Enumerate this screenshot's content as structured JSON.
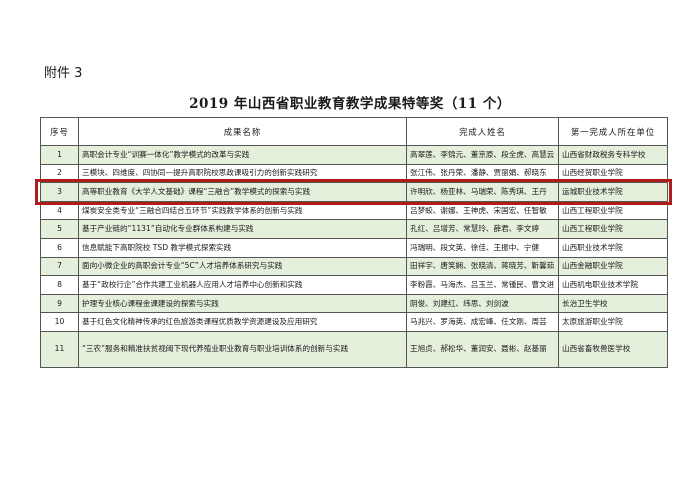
{
  "attachment_label": "附件 3",
  "title": "2019 年山西省职业教育教学成果特等奖（11 个）",
  "table": {
    "headers": [
      "序号",
      "成果名称",
      "完成人姓名",
      "第一完成人所在单位"
    ],
    "rows": [
      {
        "no": "1",
        "name": "高职会计专业“训赛一体化”教学模式的改革与实践",
        "people": "高翠莲、李锦元、董京原、段全虎、高慧云",
        "org": "山西省财政税务专科学校"
      },
      {
        "no": "2",
        "name": "三模块、四维度、四协同—提升高职院校思政课吸引力的创新实践研究",
        "people": "张江伟、张丹荣、潘静、贾丽娟、郝晓东",
        "org": "山西经贸职业学院"
      },
      {
        "no": "3",
        "name": "高等职业教育《大学人文基础》课程“三融合”教学模式的探索与实践",
        "people": "许明欣、杨亚林、马瑞荣、陈秀琪、王丹",
        "org": "运城职业技术学院"
      },
      {
        "no": "4",
        "name": "煤炭安全类专业“三融合四结合五环节”实践教学体系的创新与实践",
        "people": "吕梦蛟、谢娜、王神虎、宋国宏、任智敏",
        "org": "山西工程职业学院"
      },
      {
        "no": "5",
        "name": "基于产业链的“1131”自动化专业群体系构建与实践",
        "people": "孔红、吕增芳、常慧玲、薛君、李文婷",
        "org": "山西工程职业学院"
      },
      {
        "no": "6",
        "name": "信息赋能下高职院校 TSD 教学模式探索实践",
        "people": "冯瑞明、段文英、徐佳、王振中、宁健",
        "org": "山西职业技术学院"
      },
      {
        "no": "7",
        "name": "面向小微企业的高职会计专业“5C”人才培养体系研究与实践",
        "people": "田祥宇、唐笑娴、张晓清、蒋晓芳、靳馨茹",
        "org": "山西金融职业学院"
      },
      {
        "no": "8",
        "name": "基于“政校行企”合作共建工业机器人应用人才培养中心创新和实践",
        "people": "李粉霞、马海杰、吕玉兰、常锺民、曹文进",
        "org": "山西机电职业技术学院"
      },
      {
        "no": "9",
        "name": "护理专业核心课程金课建设的探索与实践",
        "people": "阴俊、刘建红、纬思、刘剑波",
        "org": "长治卫生学校"
      },
      {
        "no": "10",
        "name": "基于红色文化精神传承的红色旅游类课程优质教学资源建设及应用研究",
        "people": "马兆兴、罗海英、成宏峰、任文刚、周芸",
        "org": "太原旅游职业学院"
      },
      {
        "no": "11",
        "name": "“三农”服务和精准扶贫视阈下现代养殖业职业教育与职业培训体系的创新与实践",
        "people": "王旭贞、郝松华、董润安、聂彬、赵基丽",
        "org": "山西省畜牧兽医学校"
      }
    ]
  },
  "highlight_row": 3,
  "colors": {
    "alt_row_bg": "#e4efdc",
    "highlight_border": "#b01c1c"
  }
}
